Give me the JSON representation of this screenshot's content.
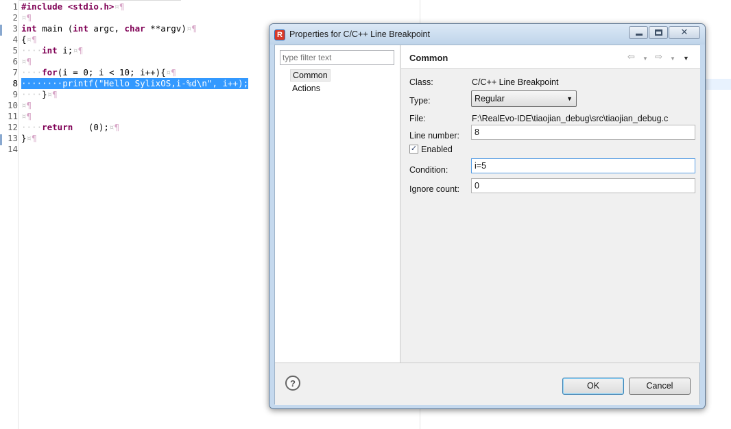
{
  "editor": {
    "lines": [
      {
        "n": "1",
        "selected": false,
        "tokens": [
          {
            "t": "#include <stdio.h>",
            "c": "kw"
          },
          {
            "t": "¤",
            "c": "ws"
          },
          {
            "t": "¶",
            "c": "pil"
          }
        ]
      },
      {
        "n": "2",
        "selected": false,
        "tokens": [
          {
            "t": "¤",
            "c": "ws"
          },
          {
            "t": "¶",
            "c": "pil"
          }
        ]
      },
      {
        "n": "3",
        "selected": false,
        "tokens": [
          {
            "t": "int",
            "c": "kw"
          },
          {
            "t": " main (",
            "c": ""
          },
          {
            "t": "int",
            "c": "kw"
          },
          {
            "t": " argc, ",
            "c": ""
          },
          {
            "t": "char",
            "c": "kw"
          },
          {
            "t": " **argv)",
            "c": ""
          },
          {
            "t": "¤",
            "c": "ws"
          },
          {
            "t": "¶",
            "c": "pil"
          }
        ]
      },
      {
        "n": "4",
        "selected": false,
        "tokens": [
          {
            "t": "{",
            "c": ""
          },
          {
            "t": "¤",
            "c": "ws"
          },
          {
            "t": "¶",
            "c": "pil"
          }
        ]
      },
      {
        "n": "5",
        "selected": false,
        "tokens": [
          {
            "t": "····",
            "c": "ws"
          },
          {
            "t": "int",
            "c": "kw"
          },
          {
            "t": " i;",
            "c": ""
          },
          {
            "t": "¤",
            "c": "ws"
          },
          {
            "t": "¶",
            "c": "pil"
          }
        ]
      },
      {
        "n": "6",
        "selected": false,
        "tokens": [
          {
            "t": "¤",
            "c": "ws"
          },
          {
            "t": "¶",
            "c": "pil"
          }
        ]
      },
      {
        "n": "7",
        "selected": false,
        "tokens": [
          {
            "t": "····",
            "c": "ws"
          },
          {
            "t": "for",
            "c": "kw"
          },
          {
            "t": "(i = 0; i < 10; i++){",
            "c": ""
          },
          {
            "t": "¤",
            "c": "ws"
          },
          {
            "t": "¶",
            "c": "pil"
          }
        ]
      },
      {
        "n": "8",
        "selected": true,
        "tokens": [
          {
            "t": "········printf(\"Hello SylixOS,i-%d\\n\", i++);",
            "c": ""
          }
        ]
      },
      {
        "n": "9",
        "selected": false,
        "tokens": [
          {
            "t": "····",
            "c": "ws"
          },
          {
            "t": "}",
            "c": ""
          },
          {
            "t": "¤",
            "c": "ws"
          },
          {
            "t": "¶",
            "c": "pil"
          }
        ]
      },
      {
        "n": "10",
        "selected": false,
        "tokens": [
          {
            "t": "¤",
            "c": "ws"
          },
          {
            "t": "¶",
            "c": "pil"
          }
        ]
      },
      {
        "n": "11",
        "selected": false,
        "tokens": [
          {
            "t": "¤",
            "c": "ws"
          },
          {
            "t": "¶",
            "c": "pil"
          }
        ]
      },
      {
        "n": "12",
        "selected": false,
        "tokens": [
          {
            "t": "····",
            "c": "ws"
          },
          {
            "t": "return",
            "c": "kw"
          },
          {
            "t": "   (0);",
            "c": ""
          },
          {
            "t": "¤",
            "c": "ws"
          },
          {
            "t": "¶",
            "c": "pil"
          }
        ]
      },
      {
        "n": "13",
        "selected": false,
        "tokens": [
          {
            "t": "}",
            "c": ""
          },
          {
            "t": "¤",
            "c": "ws"
          },
          {
            "t": "¶",
            "c": "pil"
          }
        ]
      },
      {
        "n": "14",
        "selected": false,
        "tokens": []
      }
    ]
  },
  "dialog": {
    "title": "Properties for C/C++ Line Breakpoint",
    "icon_letter": "R",
    "filter_placeholder": "type filter text",
    "tree": {
      "common": "Common",
      "actions": "Actions"
    },
    "page_title": "Common",
    "nav": {
      "back": "⇦",
      "back_menu": "▼",
      "forward": "⇨",
      "forward_menu": "▼",
      "view_menu": "▼"
    },
    "fields": {
      "class_label": "Class:",
      "class_value": "C/C++ Line Breakpoint",
      "type_label": "Type:",
      "type_value": "Regular",
      "file_label": "File:",
      "file_value": "F:\\RealEvo-IDE\\tiaojian_debug\\src\\tiaojian_debug.c",
      "line_label": "Line number:",
      "line_value": "8",
      "enabled_label": "Enabled",
      "enabled_checked": true,
      "condition_label": "Condition:",
      "condition_value": "i=5",
      "ignore_label": "Ignore count:",
      "ignore_value": "0"
    },
    "help": "?",
    "ok_label": "OK",
    "cancel_label": "Cancel"
  },
  "icons": [
    "app-icon",
    "minimize-icon",
    "maximize-icon",
    "close-icon",
    "back-arrow-icon",
    "forward-arrow-icon",
    "view-menu-icon",
    "help-icon",
    "checkmark-icon",
    "chevron-down-icon"
  ]
}
